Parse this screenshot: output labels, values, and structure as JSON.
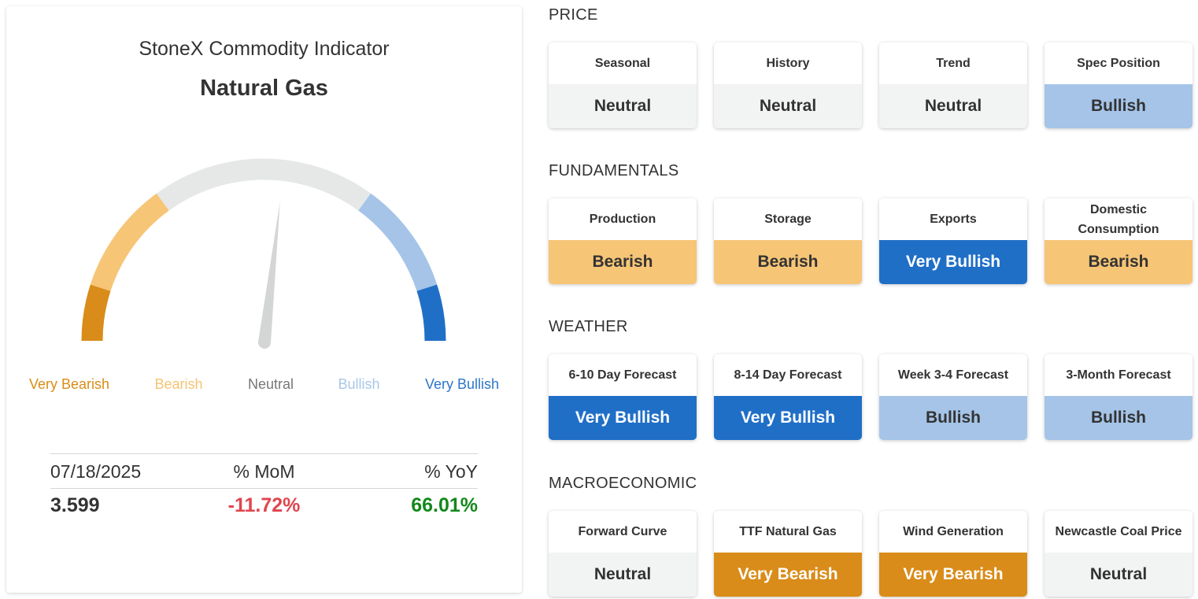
{
  "gauge": {
    "title": "StoneX Commodity Indicator",
    "commodity": "Natural Gas",
    "needle_value": 0.07,
    "labels": [
      {
        "text": "Very Bearish",
        "color": "#d88c18"
      },
      {
        "text": "Bearish",
        "color": "#f4c473"
      },
      {
        "text": "Neutral",
        "color": "#777777"
      },
      {
        "text": "Bullish",
        "color": "#a7c6e8"
      },
      {
        "text": "Very Bullish",
        "color": "#2e76c8"
      }
    ]
  },
  "stats": {
    "date": "07/18/2025",
    "mom_label": "% MoM",
    "yoy_label": "% YoY",
    "price": "3.599",
    "mom_value": "-11.72%",
    "yoy_value": "66.01%"
  },
  "colors": {
    "very_bearish": "#d98c19",
    "bearish": "#f6c576",
    "neutral": "#f2f3f3",
    "bullish": "#a5c4e8",
    "very_bullish": "#206fc7",
    "negative": "#e0454d",
    "positive": "#13881b"
  },
  "sections": [
    {
      "title": "PRICE",
      "tiles": [
        {
          "label": "Seasonal",
          "value": "Neutral",
          "level": "neutral"
        },
        {
          "label": "History",
          "value": "Neutral",
          "level": "neutral"
        },
        {
          "label": "Trend",
          "value": "Neutral",
          "level": "neutral"
        },
        {
          "label": "Spec Position",
          "value": "Bullish",
          "level": "bullish"
        }
      ]
    },
    {
      "title": "FUNDAMENTALS",
      "tiles": [
        {
          "label": "Production",
          "value": "Bearish",
          "level": "bearish"
        },
        {
          "label": "Storage",
          "value": "Bearish",
          "level": "bearish"
        },
        {
          "label": "Exports",
          "value": "Very Bullish",
          "level": "very_bullish"
        },
        {
          "label": "Domestic Consumption",
          "value": "Bearish",
          "level": "bearish"
        }
      ]
    },
    {
      "title": "WEATHER",
      "tiles": [
        {
          "label": "6-10 Day Forecast",
          "value": "Very Bullish",
          "level": "very_bullish"
        },
        {
          "label": "8-14 Day Forecast",
          "value": "Very Bullish",
          "level": "very_bullish"
        },
        {
          "label": "Week 3-4 Forecast",
          "value": "Bullish",
          "level": "bullish"
        },
        {
          "label": "3-Month Forecast",
          "value": "Bullish",
          "level": "bullish"
        }
      ]
    },
    {
      "title": "MACROECONOMIC",
      "tiles": [
        {
          "label": "Forward Curve",
          "value": "Neutral",
          "level": "neutral"
        },
        {
          "label": "TTF Natural Gas",
          "value": "Very Bearish",
          "level": "very_bearish"
        },
        {
          "label": "Wind Generation",
          "value": "Very Bearish",
          "level": "very_bearish"
        },
        {
          "label": "Newcastle Coal Price",
          "value": "Neutral",
          "level": "neutral"
        }
      ]
    }
  ]
}
